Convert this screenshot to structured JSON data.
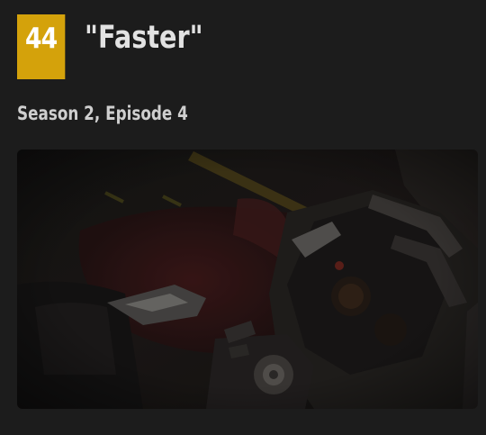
{
  "episode": {
    "rank": "44",
    "title": "\"Faster\"",
    "season_episode": "Season 2, Episode 4"
  },
  "colors": {
    "background": "#1c1c1c",
    "rank_badge": "#d4a20b",
    "title_text": "#e2e2e2",
    "subtitle_text": "#cfcfcf"
  },
  "image": {
    "subject": "dark animated still of a mechanical helmet and red-toned droid parts"
  }
}
